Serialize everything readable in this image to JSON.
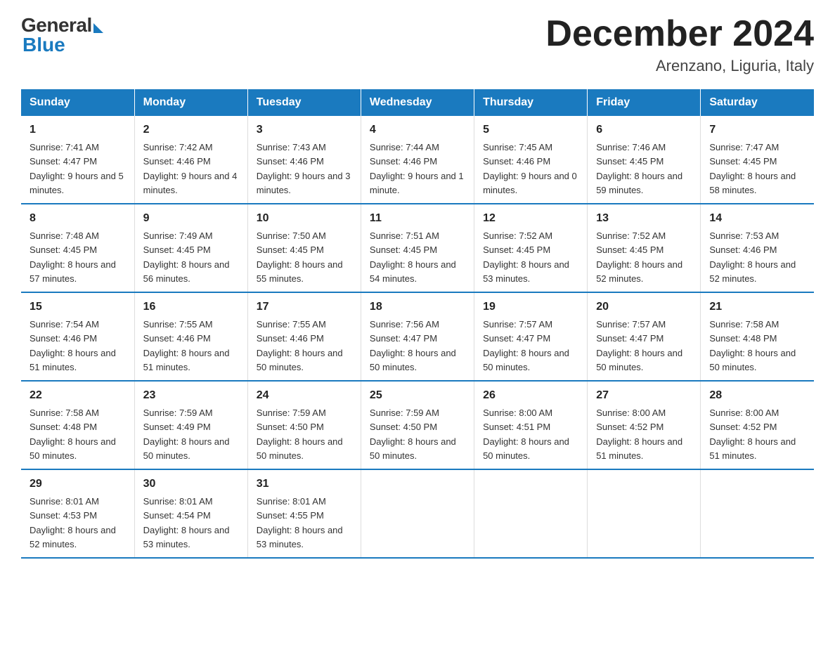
{
  "logo": {
    "general": "General",
    "blue": "Blue"
  },
  "title": "December 2024",
  "subtitle": "Arenzano, Liguria, Italy",
  "weekdays": [
    "Sunday",
    "Monday",
    "Tuesday",
    "Wednesday",
    "Thursday",
    "Friday",
    "Saturday"
  ],
  "weeks": [
    [
      {
        "day": "1",
        "sunrise": "7:41 AM",
        "sunset": "4:47 PM",
        "daylight": "9 hours and 5 minutes."
      },
      {
        "day": "2",
        "sunrise": "7:42 AM",
        "sunset": "4:46 PM",
        "daylight": "9 hours and 4 minutes."
      },
      {
        "day": "3",
        "sunrise": "7:43 AM",
        "sunset": "4:46 PM",
        "daylight": "9 hours and 3 minutes."
      },
      {
        "day": "4",
        "sunrise": "7:44 AM",
        "sunset": "4:46 PM",
        "daylight": "9 hours and 1 minute."
      },
      {
        "day": "5",
        "sunrise": "7:45 AM",
        "sunset": "4:46 PM",
        "daylight": "9 hours and 0 minutes."
      },
      {
        "day": "6",
        "sunrise": "7:46 AM",
        "sunset": "4:45 PM",
        "daylight": "8 hours and 59 minutes."
      },
      {
        "day": "7",
        "sunrise": "7:47 AM",
        "sunset": "4:45 PM",
        "daylight": "8 hours and 58 minutes."
      }
    ],
    [
      {
        "day": "8",
        "sunrise": "7:48 AM",
        "sunset": "4:45 PM",
        "daylight": "8 hours and 57 minutes."
      },
      {
        "day": "9",
        "sunrise": "7:49 AM",
        "sunset": "4:45 PM",
        "daylight": "8 hours and 56 minutes."
      },
      {
        "day": "10",
        "sunrise": "7:50 AM",
        "sunset": "4:45 PM",
        "daylight": "8 hours and 55 minutes."
      },
      {
        "day": "11",
        "sunrise": "7:51 AM",
        "sunset": "4:45 PM",
        "daylight": "8 hours and 54 minutes."
      },
      {
        "day": "12",
        "sunrise": "7:52 AM",
        "sunset": "4:45 PM",
        "daylight": "8 hours and 53 minutes."
      },
      {
        "day": "13",
        "sunrise": "7:52 AM",
        "sunset": "4:45 PM",
        "daylight": "8 hours and 52 minutes."
      },
      {
        "day": "14",
        "sunrise": "7:53 AM",
        "sunset": "4:46 PM",
        "daylight": "8 hours and 52 minutes."
      }
    ],
    [
      {
        "day": "15",
        "sunrise": "7:54 AM",
        "sunset": "4:46 PM",
        "daylight": "8 hours and 51 minutes."
      },
      {
        "day": "16",
        "sunrise": "7:55 AM",
        "sunset": "4:46 PM",
        "daylight": "8 hours and 51 minutes."
      },
      {
        "day": "17",
        "sunrise": "7:55 AM",
        "sunset": "4:46 PM",
        "daylight": "8 hours and 50 minutes."
      },
      {
        "day": "18",
        "sunrise": "7:56 AM",
        "sunset": "4:47 PM",
        "daylight": "8 hours and 50 minutes."
      },
      {
        "day": "19",
        "sunrise": "7:57 AM",
        "sunset": "4:47 PM",
        "daylight": "8 hours and 50 minutes."
      },
      {
        "day": "20",
        "sunrise": "7:57 AM",
        "sunset": "4:47 PM",
        "daylight": "8 hours and 50 minutes."
      },
      {
        "day": "21",
        "sunrise": "7:58 AM",
        "sunset": "4:48 PM",
        "daylight": "8 hours and 50 minutes."
      }
    ],
    [
      {
        "day": "22",
        "sunrise": "7:58 AM",
        "sunset": "4:48 PM",
        "daylight": "8 hours and 50 minutes."
      },
      {
        "day": "23",
        "sunrise": "7:59 AM",
        "sunset": "4:49 PM",
        "daylight": "8 hours and 50 minutes."
      },
      {
        "day": "24",
        "sunrise": "7:59 AM",
        "sunset": "4:50 PM",
        "daylight": "8 hours and 50 minutes."
      },
      {
        "day": "25",
        "sunrise": "7:59 AM",
        "sunset": "4:50 PM",
        "daylight": "8 hours and 50 minutes."
      },
      {
        "day": "26",
        "sunrise": "8:00 AM",
        "sunset": "4:51 PM",
        "daylight": "8 hours and 50 minutes."
      },
      {
        "day": "27",
        "sunrise": "8:00 AM",
        "sunset": "4:52 PM",
        "daylight": "8 hours and 51 minutes."
      },
      {
        "day": "28",
        "sunrise": "8:00 AM",
        "sunset": "4:52 PM",
        "daylight": "8 hours and 51 minutes."
      }
    ],
    [
      {
        "day": "29",
        "sunrise": "8:01 AM",
        "sunset": "4:53 PM",
        "daylight": "8 hours and 52 minutes."
      },
      {
        "day": "30",
        "sunrise": "8:01 AM",
        "sunset": "4:54 PM",
        "daylight": "8 hours and 53 minutes."
      },
      {
        "day": "31",
        "sunrise": "8:01 AM",
        "sunset": "4:55 PM",
        "daylight": "8 hours and 53 minutes."
      },
      null,
      null,
      null,
      null
    ]
  ]
}
